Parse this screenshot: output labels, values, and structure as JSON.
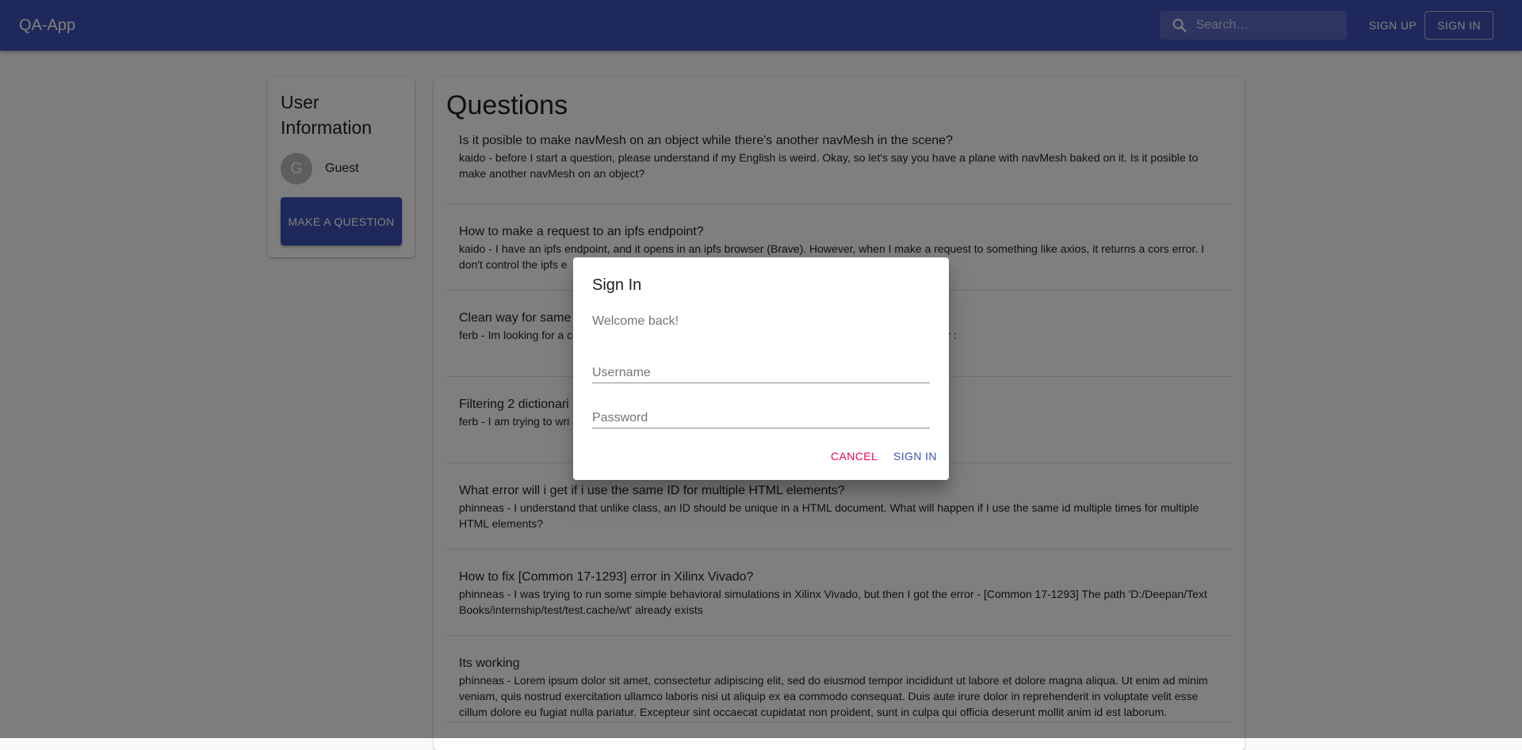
{
  "app": {
    "title": "QA-App"
  },
  "search": {
    "placeholder": "Search…"
  },
  "nav": {
    "sign_up": "SIGN UP",
    "sign_in": "SIGN IN"
  },
  "user_panel": {
    "title": "User Information",
    "avatar_letter": "G",
    "name": "Guest",
    "make_question": "MAKE A QUESTION"
  },
  "questions": {
    "heading": "Questions",
    "items": [
      {
        "title": "Is it posible to make navMesh on an object while there's another navMesh in the scene?",
        "desc": "kaido - before I start a question, please understand if my English is weird. Okay, so let's say you have a plane with navMesh baked on it. Is it posible to make another navMesh on an object?"
      },
      {
        "title": "How to make a request to an ipfs endpoint?",
        "desc": "kaido - I have an ipfs endpoint, and it opens in an ipfs browser (Brave). However, when I make a request to something like axios, it returns a cors error. I don't control the ipfs e"
      },
      {
        "title": "Clean way for same",
        "desc": "ferb - Im looking for a c                                                                                                                                         . Right now, the easiest way but seems excessive is to have something like r :"
      },
      {
        "title": "Filtering 2 dictionari",
        "desc": "ferb - I am trying to wri                                                                                                                                   aries so {'StrategyNumber': 2, 'TradingPair': 'BCHUSDT', 'value': 300"
      },
      {
        "title": "What error will i get if i use the same ID for multiple HTML elements?",
        "desc": "phinneas - I understand that unlike class, an ID should be unique in a HTML document. What will happen if I use the same id multiple times for multiple HTML elements?"
      },
      {
        "title": "How to fix [Common 17-1293] error in Xilinx Vivado?",
        "desc": "phinneas - I was trying to run some simple behavioral simulations in Xilinx Vivado, but then I got the error - [Common 17-1293] The path 'D:/Deepan/Text Books/internship/test/test.cache/wt' already exists"
      },
      {
        "title": "Its working",
        "desc": "phinneas - Lorem ipsum dolor sit amet, consectetur adipiscing elit, sed do eiusmod tempor incididunt ut labore et dolore magna aliqua. Ut enim ad minim veniam, quis nostrud exercitation ullamco laboris nisi ut aliquip ex ea commodo consequat. Duis aute irure dolor in reprehenderit in voluptate velit esse cillum dolore eu fugiat nulla pariatur. Excepteur sint occaecat cupidatat non proident, sunt in culpa qui officia deserunt mollit anim id est laborum."
      }
    ]
  },
  "dialog": {
    "title": "Sign In",
    "welcome": "Welcome back!",
    "username_placeholder": "Username",
    "password_placeholder": "Password",
    "cancel": "CANCEL",
    "submit": "SIGN IN"
  },
  "colors": {
    "primary": "#3f51b5",
    "secondary": "#f50057"
  }
}
